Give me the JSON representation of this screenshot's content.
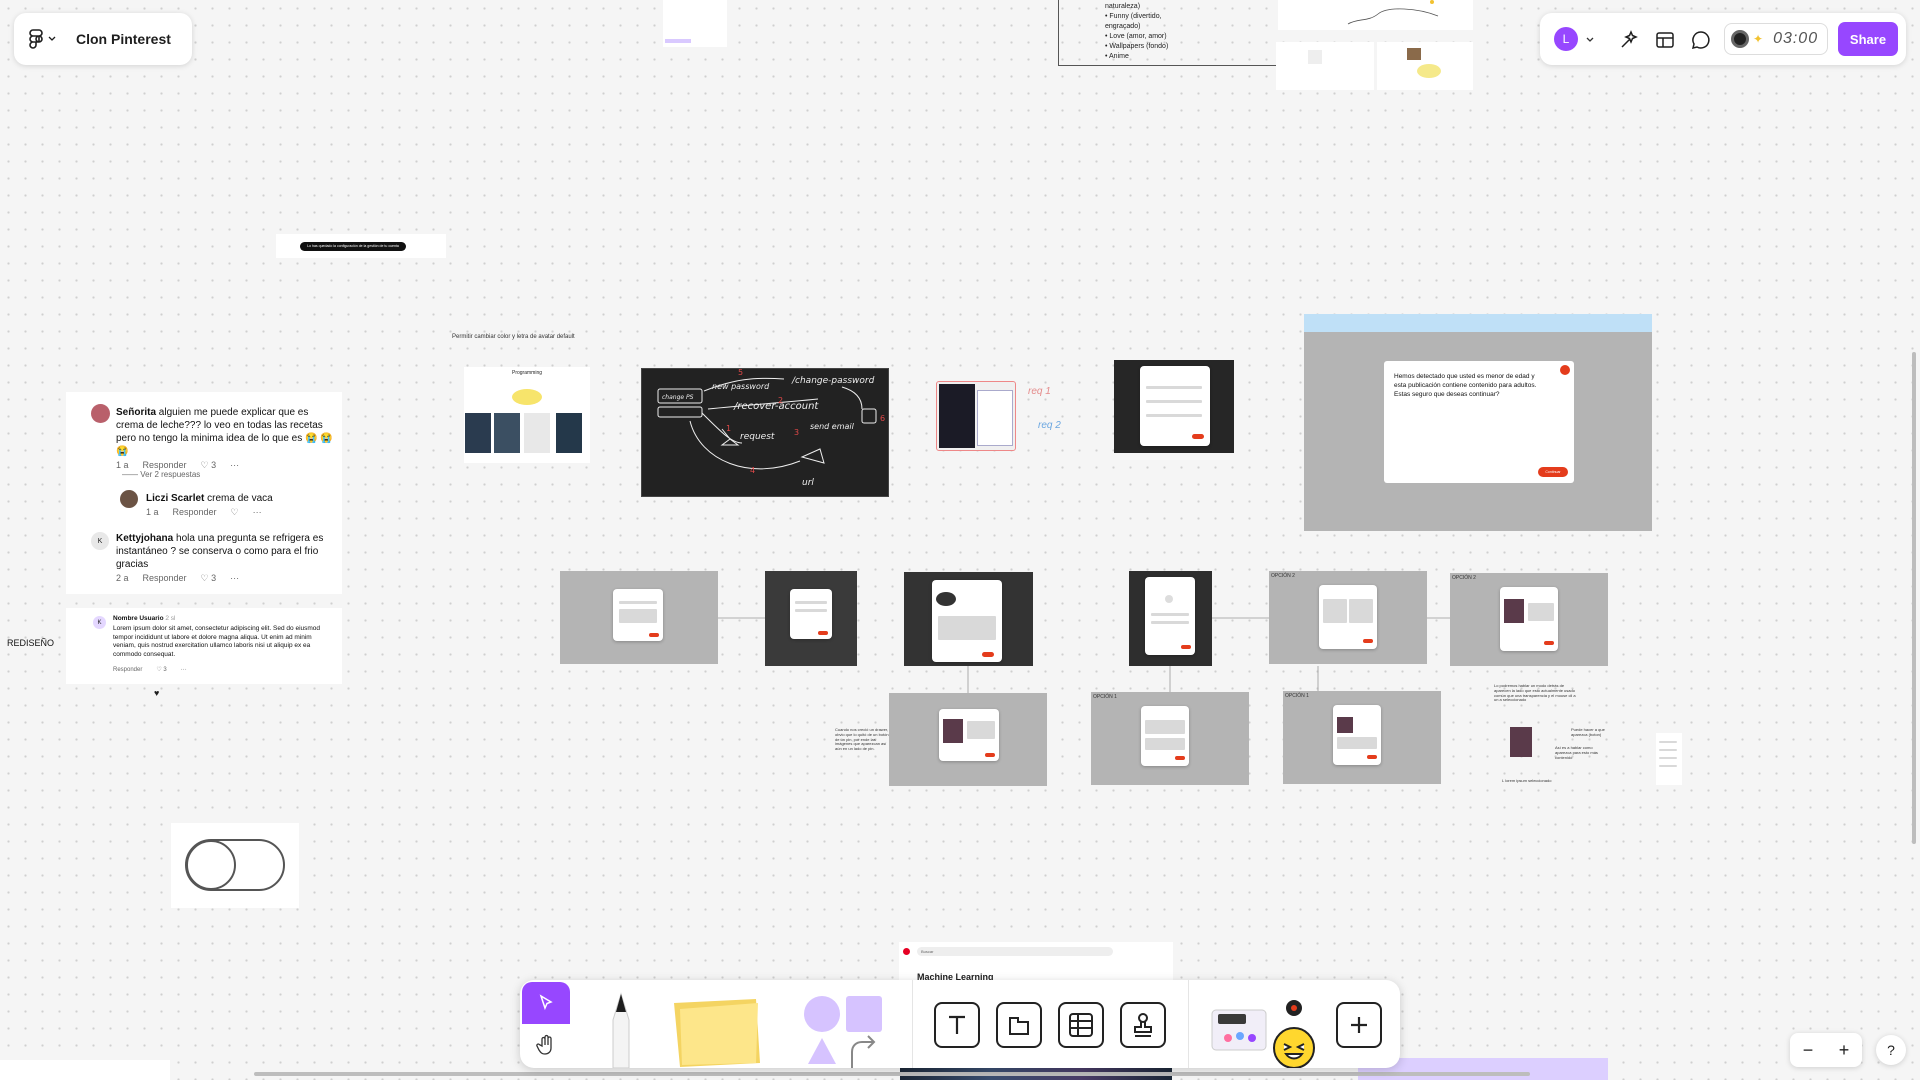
{
  "app": {
    "file_title": "Clon Pinterest",
    "user_initial": "L",
    "timer": "03:00",
    "share_label": "Share",
    "accent": "#9747ff"
  },
  "canvas": {
    "top_list": [
      "naturaleza)",
      "Funny (divertido,",
      "engraçado)",
      "Love (amor, amor)",
      "Wallpapers (fondo)",
      "Anime"
    ],
    "dark_bar_text": "Lo has quedado la configuración de la gestión de tu cuenta",
    "avatar_note": "Permitir cambiar color y letra de avatar default",
    "redesign_label": "REDISEÑO",
    "age_warning_text": "Hemos detectado que usted es menor de edad y esta publicación contiene contenido para adultos. Estas seguro que deseas continuar?",
    "age_warning_button": "Continuar",
    "board_label": "Programming",
    "search_placeholder": "Buscar",
    "preview_title": "Machine Learning",
    "handwriting": {
      "change_password": "/change-password",
      "new_password": "new password",
      "recover_account": "/recover-account",
      "request": "request",
      "send_email": "send email",
      "url": "url",
      "change_ps": "change PS",
      "step1": "1",
      "step2": "2",
      "step3": "3",
      "step4": "4",
      "step5": "5",
      "step6": "6"
    },
    "req_1": "req 1",
    "req_2": "req 2",
    "option_labels": [
      "OPCIÓN 2",
      "OPCIÓN 2",
      "OPCIÓN 1",
      "OPCIÓN 1"
    ],
    "note_left": "Cuando nos creció un drawer, obvio que lo quitó de un botón de un pin, por ende las imágenes que aparezcan así aún en un lado de pin.",
    "note_right": "Lo podremos hablar un modo detrás de aparecen la lado que esto actualmente usado común que una transparencia y el mouse cli a un a seleccionado",
    "note_right_small_1": "Puede hacer a que aparezca (boton)",
    "note_right_small_2": "Así es a hablar como aparezca para esto más contenido",
    "note_right_small_3": "L lorem ipsum seleccionado"
  },
  "comments": [
    {
      "author": "Señorita",
      "text": "alguien me puede explicar que es crema de leche??? lo veo en todas las recetas pero no tengo la minima idea de lo que es 😭 😭 😭",
      "time": "1 a",
      "reply": "Responder",
      "likes": "3"
    },
    {
      "view_replies": "Ver 2 respuestas"
    },
    {
      "author": "Liczi Scarlet",
      "text": "crema de vaca",
      "time": "1 a",
      "reply": "Responder"
    },
    {
      "author": "Kettyjohana",
      "text": "hola una pregunta se refrigera es instantáneo ? se conserva o como para el frio gracias",
      "time": "2 a",
      "reply": "Responder",
      "likes": "3"
    }
  ],
  "redesign_comment": {
    "author": "Nombre Usuario",
    "time": "2 sl",
    "text": "Lorem ipsum dolor sit amet, consectetur adipiscing elit. Sed do eiusmod tempor incididunt ut labore et dolore magna aliqua. Ut enim ad minim veniam, quis nostrud exercitation ullamco laboris nisi ut aliquip ex ea commodo consequat.",
    "reply": "Responder",
    "likes": "3"
  },
  "toolbar": {
    "tools": [
      "move",
      "hand",
      "pen",
      "sticky-note",
      "shapes",
      "connector",
      "text",
      "section",
      "table",
      "stamp",
      "widgets",
      "more"
    ]
  },
  "zoom": {
    "minus": "−",
    "plus": "+",
    "help": "?"
  }
}
